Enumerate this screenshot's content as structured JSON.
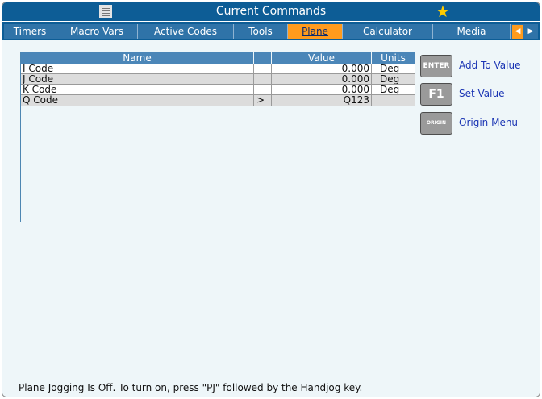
{
  "window": {
    "title": "Current Commands"
  },
  "tabs": [
    {
      "label": "Timers"
    },
    {
      "label": "Macro Vars"
    },
    {
      "label": "Active Codes"
    },
    {
      "label": "Tools"
    },
    {
      "label": "Plane"
    },
    {
      "label": "Calculator"
    },
    {
      "label": "Media"
    }
  ],
  "active_tab": "Plane",
  "table": {
    "headers": {
      "name": "Name",
      "value": "Value",
      "units": "Units"
    },
    "rows": [
      {
        "name": "I Code",
        "marker": "",
        "value": "0.000",
        "units": "Deg"
      },
      {
        "name": "J Code",
        "marker": "",
        "value": "0.000",
        "units": "Deg"
      },
      {
        "name": "K Code",
        "marker": "",
        "value": "0.000",
        "units": "Deg"
      },
      {
        "name": "Q Code",
        "marker": ">",
        "value": "Q123",
        "units": ""
      }
    ]
  },
  "actions": [
    {
      "key": "ENTER",
      "label": "Add To Value"
    },
    {
      "key": "F1",
      "label": "Set Value"
    },
    {
      "key": "ORIGIN",
      "label": "Origin Menu"
    }
  ],
  "status_text": "Plane Jogging Is Off.  To turn on, press \"PJ\" followed by the Handjog key.",
  "colors": {
    "title_bar": "#0d5d96",
    "active_tab": "#ff9b1d",
    "table_header": "#4b86b8",
    "action_label": "#1b35b4"
  },
  "icons": {
    "menu": "hamburger-menu-icon",
    "favorite": "star-icon",
    "tab_left": "scroll-left-icon",
    "tab_right": "scroll-right-icon"
  }
}
